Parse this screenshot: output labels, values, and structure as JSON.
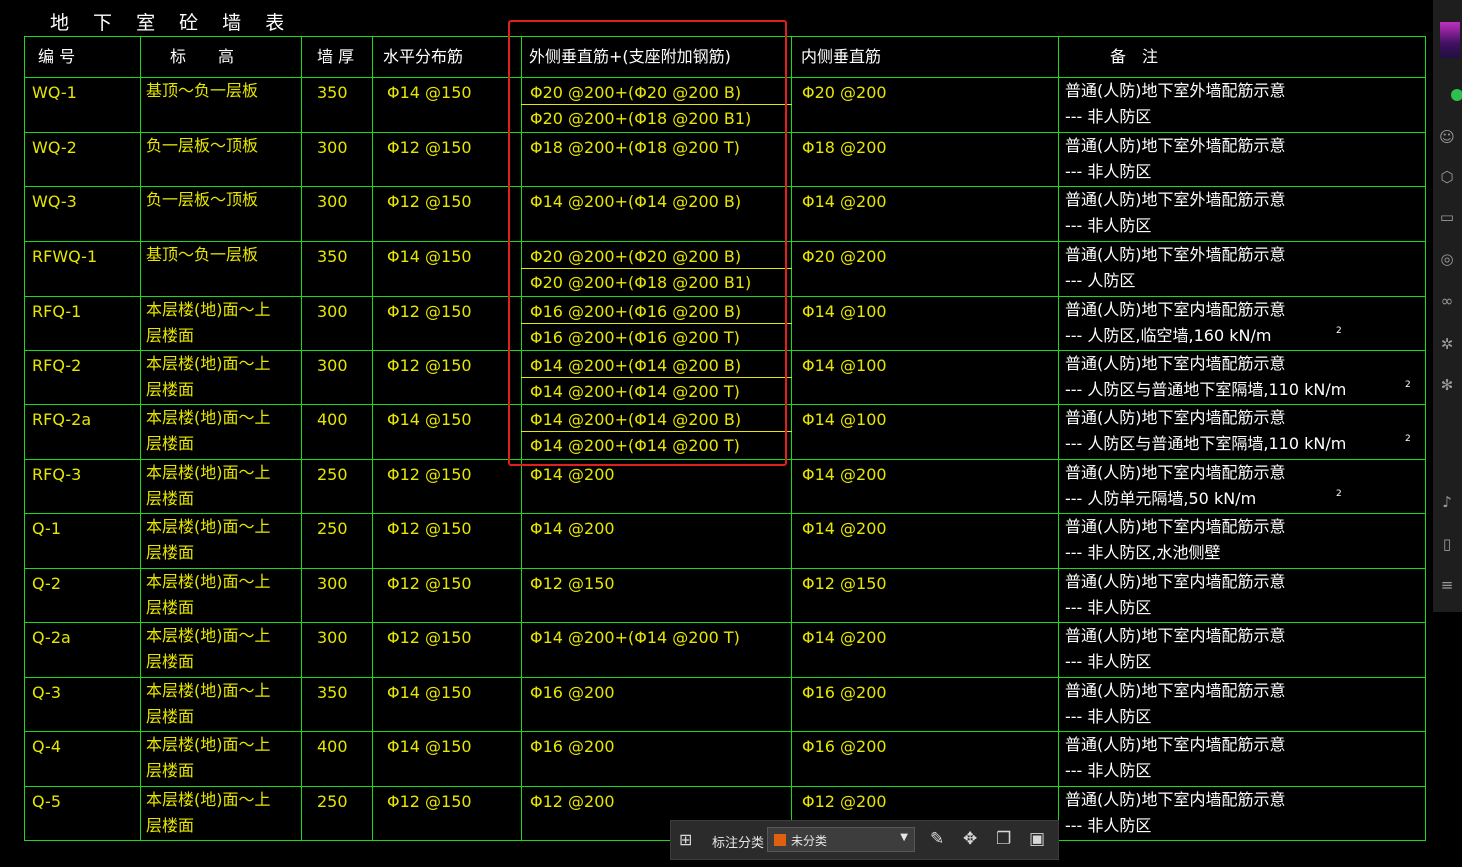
{
  "title": "地 下 室 砼 墙 表",
  "colors": {
    "grid_line": "#1ed81e",
    "yellow_text": "#e6e600",
    "white_text": "#ffffff",
    "highlight_box": "#e02020",
    "category_swatch": "#e06010"
  },
  "headers": {
    "id": "编 号",
    "elevation": "标　　高",
    "thickness": "墙 厚",
    "horiz": "水平分布筋",
    "outer": "外侧垂直筋+(支座附加钢筋)",
    "inner": "内侧垂直筋",
    "note": "备　注"
  },
  "rows": [
    {
      "id": "WQ-1",
      "elev": [
        "基顶～负一层板",
        ""
      ],
      "thick": "350",
      "horiz": "Φ14 @150",
      "outer": [
        "Φ20 @200+(Φ20 @200 B)",
        "Φ20 @200+(Φ18 @200 B1)"
      ],
      "inner": "Φ20 @200",
      "note1": "普通(人防)地下室外墙配筋示意",
      "note2": "--- 非人防区",
      "note_sup": ""
    },
    {
      "id": "WQ-2",
      "elev": [
        "负一层板～顶板",
        ""
      ],
      "thick": "300",
      "horiz": "Φ12 @150",
      "outer": [
        "Φ18 @200+(Φ18 @200 T)",
        ""
      ],
      "inner": "Φ18 @200",
      "note1": "普通(人防)地下室外墙配筋示意",
      "note2": "--- 非人防区",
      "note_sup": ""
    },
    {
      "id": "WQ-3",
      "elev": [
        "负一层板～顶板",
        ""
      ],
      "thick": "300",
      "horiz": "Φ12 @150",
      "outer": [
        "Φ14 @200+(Φ14 @200 B)",
        ""
      ],
      "inner": "Φ14 @200",
      "note1": "普通(人防)地下室外墙配筋示意",
      "note2": "--- 非人防区",
      "note_sup": ""
    },
    {
      "id": "RFWQ-1",
      "elev": [
        "基顶～负一层板",
        ""
      ],
      "thick": "350",
      "horiz": "Φ14 @150",
      "outer": [
        "Φ20 @200+(Φ20 @200 B)",
        "Φ20 @200+(Φ18 @200 B1)"
      ],
      "inner": "Φ20 @200",
      "note1": "普通(人防)地下室外墙配筋示意",
      "note2": "--- 人防区",
      "note_sup": ""
    },
    {
      "id": "RFQ-1",
      "elev": [
        "本层楼(地)面～上",
        "层楼面"
      ],
      "thick": "300",
      "horiz": "Φ12 @150",
      "outer": [
        "Φ16 @200+(Φ16 @200 B)",
        "Φ16 @200+(Φ16 @200 T)"
      ],
      "inner": "Φ14 @100",
      "note1": "普通(人防)地下室内墙配筋示意",
      "note2": "--- 人防区,临空墙,160 kN/m",
      "note_sup": "2"
    },
    {
      "id": "RFQ-2",
      "elev": [
        "本层楼(地)面～上",
        "层楼面"
      ],
      "thick": "300",
      "horiz": "Φ12 @150",
      "outer": [
        "Φ14 @200+(Φ14 @200 B)",
        "Φ14 @200+(Φ14 @200 T)"
      ],
      "inner": "Φ14 @100",
      "note1": "普通(人防)地下室内墙配筋示意",
      "note2": "--- 人防区与普通地下室隔墙,110 kN/m",
      "note_sup": "2"
    },
    {
      "id": "RFQ-2a",
      "elev": [
        "本层楼(地)面～上",
        "层楼面"
      ],
      "thick": "400",
      "horiz": "Φ14 @150",
      "outer": [
        "Φ14 @200+(Φ14 @200 B)",
        "Φ14 @200+(Φ14 @200 T)"
      ],
      "inner": "Φ14 @100",
      "note1": "普通(人防)地下室内墙配筋示意",
      "note2": "--- 人防区与普通地下室隔墙,110 kN/m",
      "note_sup": "2"
    },
    {
      "id": "RFQ-3",
      "elev": [
        "本层楼(地)面～上",
        "层楼面"
      ],
      "thick": "250",
      "horiz": "Φ12 @150",
      "outer": [
        "Φ14 @200",
        ""
      ],
      "inner": "Φ14 @200",
      "note1": "普通(人防)地下室内墙配筋示意",
      "note2": "--- 人防单元隔墙,50 kN/m",
      "note_sup": "2"
    },
    {
      "id": "Q-1",
      "elev": [
        "本层楼(地)面～上",
        "层楼面"
      ],
      "thick": "250",
      "horiz": "Φ12 @150",
      "outer": [
        "Φ14 @200",
        ""
      ],
      "inner": "Φ14 @200",
      "note1": "普通(人防)地下室内墙配筋示意",
      "note2": "--- 非人防区,水池侧壁",
      "note_sup": ""
    },
    {
      "id": "Q-2",
      "elev": [
        "本层楼(地)面～上",
        "层楼面"
      ],
      "thick": "300",
      "horiz": "Φ12 @150",
      "outer": [
        "Φ12 @150",
        ""
      ],
      "inner": "Φ12 @150",
      "note1": "普通(人防)地下室内墙配筋示意",
      "note2": "--- 非人防区",
      "note_sup": ""
    },
    {
      "id": "Q-2a",
      "elev": [
        "本层楼(地)面～上",
        "层楼面"
      ],
      "thick": "300",
      "horiz": "Φ12 @150",
      "outer": [
        "Φ14 @200+(Φ14 @200 T)",
        ""
      ],
      "inner": "Φ14 @200",
      "note1": "普通(人防)地下室内墙配筋示意",
      "note2": "--- 非人防区",
      "note_sup": ""
    },
    {
      "id": "Q-3",
      "elev": [
        "本层楼(地)面～上",
        "层楼面"
      ],
      "thick": "350",
      "horiz": "Φ14 @150",
      "outer": [
        "Φ16 @200",
        ""
      ],
      "inner": "Φ16 @200",
      "note1": "普通(人防)地下室内墙配筋示意",
      "note2": "--- 非人防区",
      "note_sup": ""
    },
    {
      "id": "Q-4",
      "elev": [
        "本层楼(地)面～上",
        "层楼面"
      ],
      "thick": "400",
      "horiz": "Φ14 @150",
      "outer": [
        "Φ16 @200",
        ""
      ],
      "inner": "Φ16 @200",
      "note1": "普通(人防)地下室内墙配筋示意",
      "note2": "--- 非人防区",
      "note_sup": ""
    },
    {
      "id": "Q-5",
      "elev": [
        "本层楼(地)面～上",
        "层楼面"
      ],
      "thick": "250",
      "horiz": "Φ12 @150",
      "outer": [
        "Φ12 @200",
        ""
      ],
      "inner": "Φ12 @200",
      "note1": "普通(人防)地下室内墙配筋示意",
      "note2": "--- 非人防区",
      "note_sup": ""
    }
  ],
  "toolbar": {
    "grid_icon": "grid-icon",
    "label": "标注分类",
    "select_value": "未分类",
    "buttons": [
      "edit-icon",
      "move-icon",
      "copy-icon",
      "paste-icon"
    ]
  },
  "sidebar": {
    "icons": [
      "chat-icon",
      "user-icon",
      "cube-icon",
      "folder-icon",
      "aperture-icon",
      "link-icon",
      "gear-icon",
      "bug-icon",
      "music-icon",
      "tablet-icon",
      "menu-icon"
    ]
  }
}
